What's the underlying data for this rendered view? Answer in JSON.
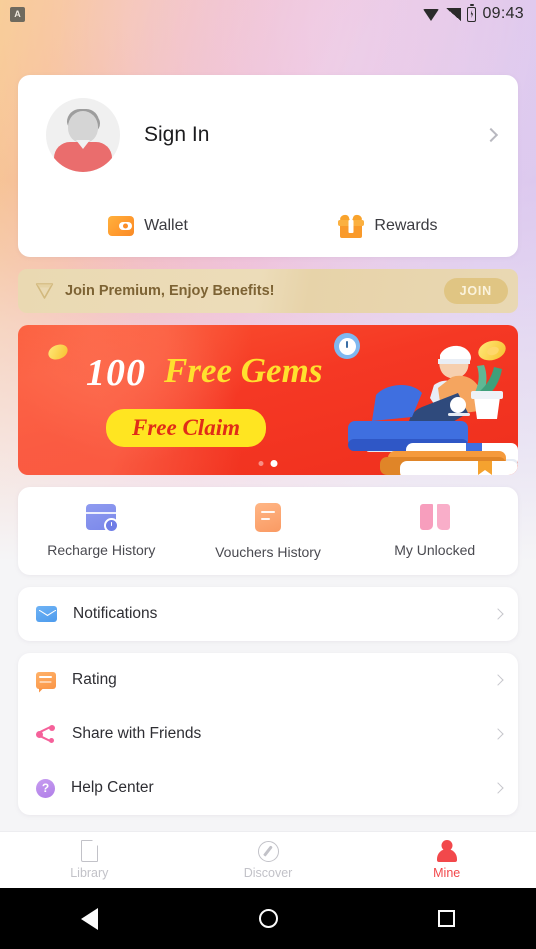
{
  "status_bar": {
    "app_badge": "A",
    "time": "09:43",
    "icons": [
      "wifi-icon",
      "signal-icon",
      "battery-charging-icon"
    ]
  },
  "profile": {
    "sign_in_label": "Sign In",
    "avatar_icon": "user-avatar",
    "chevron_icon": "chevron-right-icon",
    "shortcuts": [
      {
        "label": "Wallet",
        "icon": "wallet-icon"
      },
      {
        "label": "Rewards",
        "icon": "gift-icon"
      }
    ]
  },
  "premium_banner": {
    "icon": "diamond-icon",
    "text": "Join Premium, Enjoy Benefits!",
    "button_label": "JOIN",
    "bg_color": "#eadab5",
    "text_color": "#7d6334",
    "button_color": "#e0c583"
  },
  "promo_banner": {
    "headline_amount": "100",
    "headline_text": "Free Gems",
    "cta_label": "Free Claim",
    "bg_color": "#f53824",
    "amount_color": "#ffffff",
    "text_color": "#ffe02e",
    "cta_bg": "#ffe521",
    "cta_text_color": "#e02d18",
    "page_count": 2,
    "active_page": 2,
    "illustration": "person-reading-on-books"
  },
  "quick_actions": [
    {
      "label": "Recharge History",
      "icon": "recharge-history-icon"
    },
    {
      "label": "Vouchers History",
      "icon": "voucher-history-icon"
    },
    {
      "label": "My Unlocked",
      "icon": "open-book-icon"
    }
  ],
  "menu_group_1": [
    {
      "label": "Notifications",
      "icon": "mail-icon"
    }
  ],
  "menu_group_2": [
    {
      "label": "Rating",
      "icon": "chat-bubble-icon"
    },
    {
      "label": "Share with Friends",
      "icon": "share-icon"
    },
    {
      "label": "Help Center",
      "icon": "question-mark-icon"
    }
  ],
  "tab_bar": {
    "active_color": "#f2484b",
    "inactive_color": "#c2c2c8",
    "tabs": [
      {
        "label": "Library",
        "icon": "book-outline-icon",
        "active": false
      },
      {
        "label": "Discover",
        "icon": "compass-icon",
        "active": false
      },
      {
        "label": "Mine",
        "icon": "person-icon",
        "active": true
      }
    ]
  },
  "android_nav": {
    "back": "back-triangle-icon",
    "home": "home-circle-icon",
    "recents": "recents-square-icon"
  }
}
